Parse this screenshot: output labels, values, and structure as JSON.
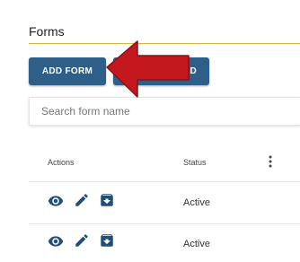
{
  "page": {
    "title": "Forms"
  },
  "toolbar": {
    "add_form_label": "ADD FORM",
    "wizard_label_visible": "ARD"
  },
  "search": {
    "placeholder": "Search form name"
  },
  "table": {
    "columns": [
      "Actions",
      "Status"
    ],
    "rows": [
      {
        "status": "Active"
      },
      {
        "status": "Active"
      }
    ]
  },
  "colors": {
    "primary_button": "#2e5f88",
    "title_underline": "#d8b24a",
    "annotation_arrow": "#c4171e",
    "icon": "#1f4e79"
  },
  "icons": [
    "eye-icon",
    "pencil-icon",
    "archive-icon",
    "more-vert-icon",
    "arrow-annotation"
  ]
}
